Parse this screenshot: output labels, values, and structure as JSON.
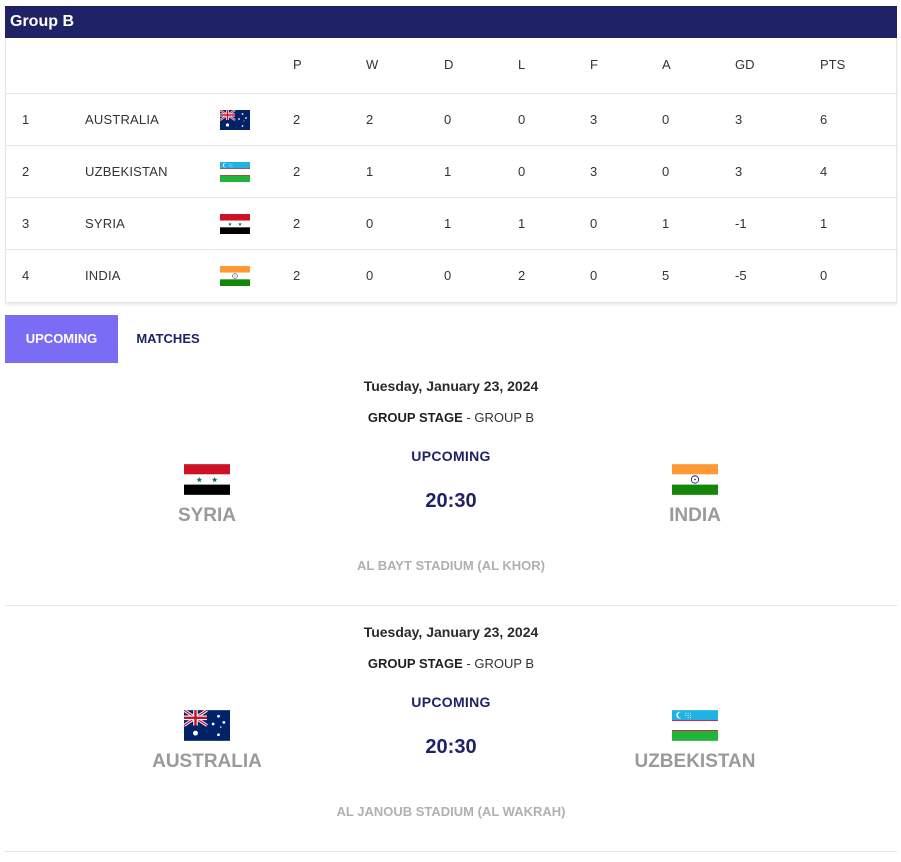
{
  "group": {
    "title": "Group B"
  },
  "table": {
    "headers": {
      "p": "P",
      "w": "W",
      "d": "D",
      "l": "L",
      "f": "F",
      "a": "A",
      "gd": "GD",
      "pts": "PTS"
    },
    "rows": [
      {
        "pos": "1",
        "team": "AUSTRALIA",
        "flag": "australia-flag",
        "p": "2",
        "w": "2",
        "d": "0",
        "l": "0",
        "f": "3",
        "a": "0",
        "gd": "3",
        "pts": "6"
      },
      {
        "pos": "2",
        "team": "UZBEKISTAN",
        "flag": "uzbekistan-flag",
        "p": "2",
        "w": "1",
        "d": "1",
        "l": "0",
        "f": "3",
        "a": "0",
        "gd": "3",
        "pts": "4"
      },
      {
        "pos": "3",
        "team": "SYRIA",
        "flag": "syria-flag",
        "p": "2",
        "w": "0",
        "d": "1",
        "l": "1",
        "f": "0",
        "a": "1",
        "gd": "-1",
        "pts": "1"
      },
      {
        "pos": "4",
        "team": "INDIA",
        "flag": "india-flag",
        "p": "2",
        "w": "0",
        "d": "0",
        "l": "2",
        "f": "0",
        "a": "5",
        "gd": "-5",
        "pts": "0"
      }
    ]
  },
  "tabs": {
    "upcoming": "UPCOMING",
    "matches": "MATCHES"
  },
  "matches": [
    {
      "date": "Tuesday, January 23, 2024",
      "stage_bold": "GROUP STAGE",
      "stage_rest": " - GROUP B",
      "status": "UPCOMING",
      "time": "20:30",
      "home": {
        "name": "SYRIA",
        "flag": "syria-flag"
      },
      "away": {
        "name": "INDIA",
        "flag": "india-flag"
      },
      "venue": "AL BAYT STADIUM (AL KHOR)"
    },
    {
      "date": "Tuesday, January 23, 2024",
      "stage_bold": "GROUP STAGE",
      "stage_rest": " - GROUP B",
      "status": "UPCOMING",
      "time": "20:30",
      "home": {
        "name": "AUSTRALIA",
        "flag": "australia-flag"
      },
      "away": {
        "name": "UZBEKISTAN",
        "flag": "uzbekistan-flag"
      },
      "venue": "AL JANOUB STADIUM (AL WAKRAH)"
    }
  ],
  "colors": {
    "header_bg": "#1f2366",
    "tab_active": "#7b6cf6",
    "time_text": "#1f2366",
    "team_name": "#9a9a9a"
  }
}
